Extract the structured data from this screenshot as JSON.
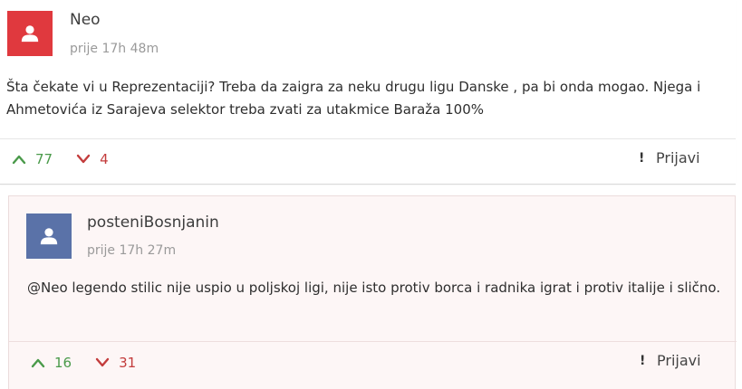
{
  "comments": [
    {
      "username": "Neo",
      "timestamp": "prije 17h 48m",
      "text": "Šta čekate vi u Reprezentaciji? Treba da zaigra za neku drugu ligu Danske , pa bi onda mogao. Njega i Ahmetovića iz Sarajeva selektor treba zvati za utakmice Baraža 100%",
      "upvotes": "77",
      "downvotes": "4",
      "report_label": "Prijavi",
      "avatar_color": "#e0393e"
    },
    {
      "username": "posteniBosnjanin",
      "timestamp": "prije 17h 27m",
      "text": "@Neo legendo stilic nije uspio u poljskoj ligi, nije isto protiv borca i radnika igrat i protiv italije i slično.",
      "upvotes": "16",
      "downvotes": "31",
      "report_label": "Prijavi",
      "avatar_color": "#5a72a8"
    }
  ],
  "colors": {
    "upvote": "#4a9a4a",
    "downvote": "#c33c3c",
    "reply_background": "#fdf6f6"
  },
  "icons": {
    "avatar": "user-icon",
    "upvote": "chevron-up-icon",
    "downvote": "chevron-down-icon",
    "report": "exclamation-icon"
  }
}
